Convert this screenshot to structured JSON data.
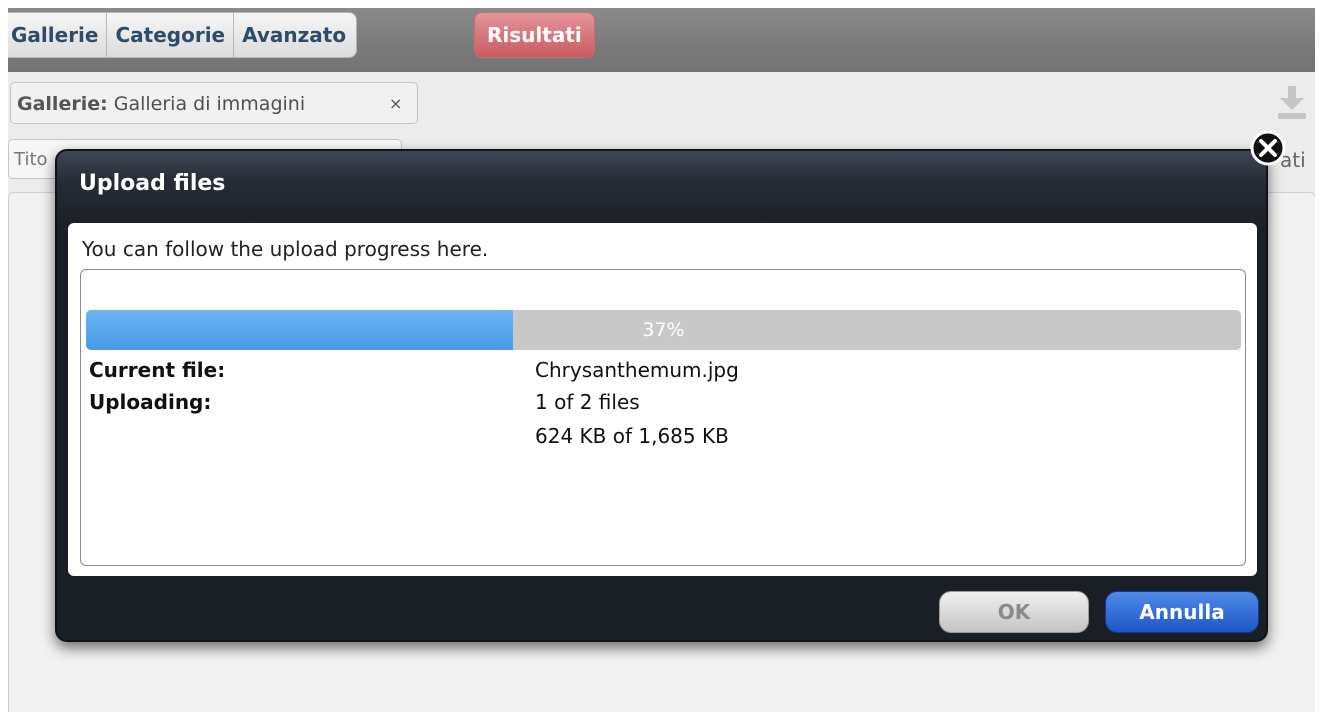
{
  "app": {
    "tabs": [
      "Gallerie",
      "Categorie",
      "Avanzato"
    ],
    "results_tab": "Risultati",
    "filter": {
      "label": "Gallerie:",
      "value": "Galleria di immagini",
      "remove": "×"
    },
    "search_partial": "Tito",
    "right_partial": "ati"
  },
  "dialog": {
    "title": "Upload files",
    "intro": "You can follow the upload progress here.",
    "progress_percent": 37,
    "progress_label": "37%",
    "current_file_label": "Current file:",
    "current_file_value": "Chrysanthemum.jpg",
    "uploading_label": "Uploading:",
    "uploading_count": "1 of 2 files",
    "uploading_size": "624 KB of 1,685 KB",
    "ok_label": "OK",
    "cancel_label": "Annulla"
  },
  "colors": {
    "progress_fill": "#4a9ae6",
    "results_tab": "#c95b62",
    "cancel_button": "#1d56c7"
  }
}
